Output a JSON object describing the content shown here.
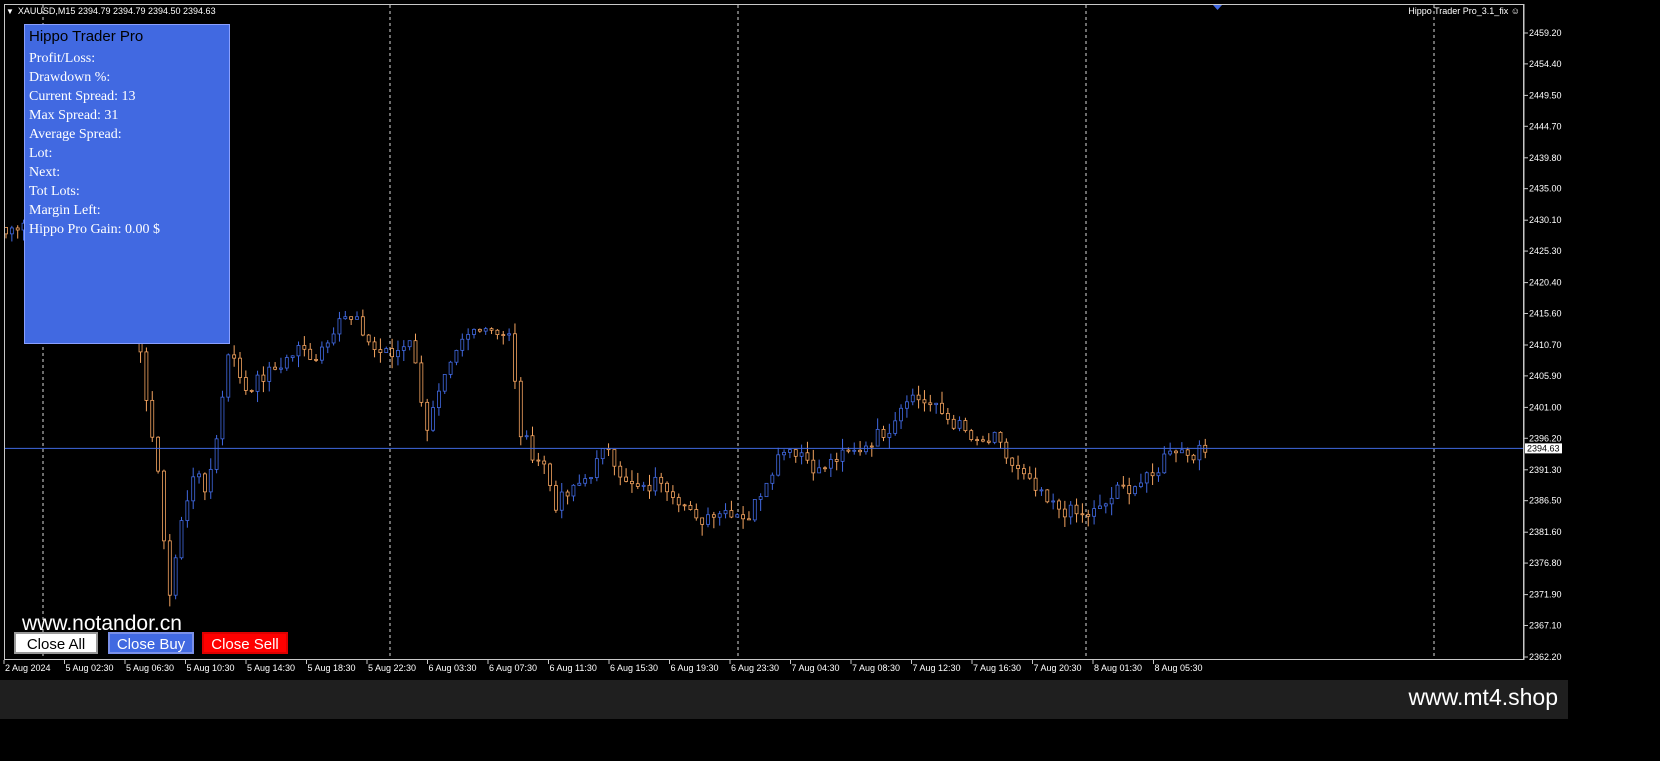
{
  "header": {
    "symbol_line": "XAUUSD,M15  2394.79 2394.79 2394.50 2394.63",
    "indicator_name": "Hippo Trader Pro_3.1_fix"
  },
  "panel": {
    "title": "Hippo Trader Pro",
    "lines": [
      "Profit/Loss:",
      "Drawdown %:",
      "Current Spread: 13",
      "Max Spread: 31",
      "Average Spread:",
      "Lot:",
      "Next:",
      "Tot Lots:",
      "Margin Left:",
      "Hippo Pro Gain: 0.00 $"
    ]
  },
  "watermark": "www.notandor.cn",
  "buttons": {
    "close_all": "Close All",
    "close_buy": "Close Buy",
    "close_sell": "Close Sell"
  },
  "footer": {
    "url": "www.mt4.shop"
  },
  "colors": {
    "background": "#000000",
    "bull_candle": "#4169e1",
    "bear_candle": "#f4a460",
    "price_line": "#4169e1",
    "panel": "#4169e1",
    "close_sell": "#ff0000"
  },
  "chart_data": {
    "type": "candlestick",
    "symbol": "XAUUSD",
    "timeframe": "M15",
    "last_price": 2394.63,
    "price_label": "2394.63",
    "ylim": [
      2362.2,
      2462.1
    ],
    "y_ticks": [
      "2459.20",
      "2454.40",
      "2449.50",
      "2444.70",
      "2439.80",
      "2435.00",
      "2430.10",
      "2425.30",
      "2420.40",
      "2415.60",
      "2410.70",
      "2405.90",
      "2401.00",
      "2396.20",
      "2391.30",
      "2386.50",
      "2381.60",
      "2376.80",
      "2371.90",
      "2367.10",
      "2362.20"
    ],
    "x_ticks": [
      "2 Aug 2024",
      "5 Aug 02:30",
      "5 Aug 06:30",
      "5 Aug 10:30",
      "5 Aug 14:30",
      "5 Aug 18:30",
      "5 Aug 22:30",
      "6 Aug 03:30",
      "6 Aug 07:30",
      "6 Aug 11:30",
      "6 Aug 15:30",
      "6 Aug 19:30",
      "6 Aug 23:30",
      "7 Aug 04:30",
      "7 Aug 08:30",
      "7 Aug 12:30",
      "7 Aug 16:30",
      "7 Aug 20:30",
      "8 Aug 01:30",
      "8 Aug 05:30"
    ],
    "grid": "vertical dashed, every 5 time labels",
    "path_anchors": [
      [
        0,
        2428
      ],
      [
        4,
        2431
      ],
      [
        6,
        2436
      ],
      [
        8,
        2442
      ],
      [
        10,
        2440
      ],
      [
        13,
        2433
      ],
      [
        16,
        2430
      ],
      [
        19,
        2424
      ],
      [
        22,
        2414
      ],
      [
        24,
        2403
      ],
      [
        26,
        2390
      ],
      [
        28,
        2372
      ],
      [
        30,
        2383
      ],
      [
        32,
        2391
      ],
      [
        34,
        2388
      ],
      [
        36,
        2396
      ],
      [
        38,
        2410
      ],
      [
        41,
        2404
      ],
      [
        43,
        2405
      ],
      [
        46,
        2407
      ],
      [
        50,
        2410
      ],
      [
        53,
        2409
      ],
      [
        57,
        2415
      ],
      [
        60,
        2414
      ],
      [
        63,
        2410
      ],
      [
        66,
        2409
      ],
      [
        69,
        2412
      ],
      [
        72,
        2398
      ],
      [
        75,
        2405
      ],
      [
        78,
        2411
      ],
      [
        81,
        2414
      ],
      [
        84,
        2413
      ],
      [
        86,
        2412
      ],
      [
        88,
        2397
      ],
      [
        90,
        2394
      ],
      [
        92,
        2392
      ],
      [
        94,
        2386
      ],
      [
        97,
        2388
      ],
      [
        100,
        2391
      ],
      [
        103,
        2395
      ],
      [
        106,
        2389
      ],
      [
        109,
        2388
      ],
      [
        112,
        2390
      ],
      [
        115,
        2387
      ],
      [
        118,
        2383
      ],
      [
        121,
        2385
      ],
      [
        124,
        2385
      ],
      [
        127,
        2384
      ],
      [
        130,
        2390
      ],
      [
        133,
        2395
      ],
      [
        136,
        2394
      ],
      [
        139,
        2391
      ],
      [
        142,
        2393
      ],
      [
        145,
        2394
      ],
      [
        148,
        2396
      ],
      [
        151,
        2398
      ],
      [
        154,
        2403
      ],
      [
        157,
        2402
      ],
      [
        160,
        2400
      ],
      [
        163,
        2398
      ],
      [
        166,
        2395
      ],
      [
        169,
        2396
      ],
      [
        172,
        2392
      ],
      [
        175,
        2389
      ],
      [
        178,
        2386
      ],
      [
        181,
        2385
      ],
      [
        184,
        2384
      ],
      [
        187,
        2385
      ],
      [
        190,
        2388
      ],
      [
        193,
        2389
      ],
      [
        196,
        2390
      ],
      [
        199,
        2395
      ],
      [
        202,
        2394
      ],
      [
        205,
        2394
      ]
    ]
  }
}
